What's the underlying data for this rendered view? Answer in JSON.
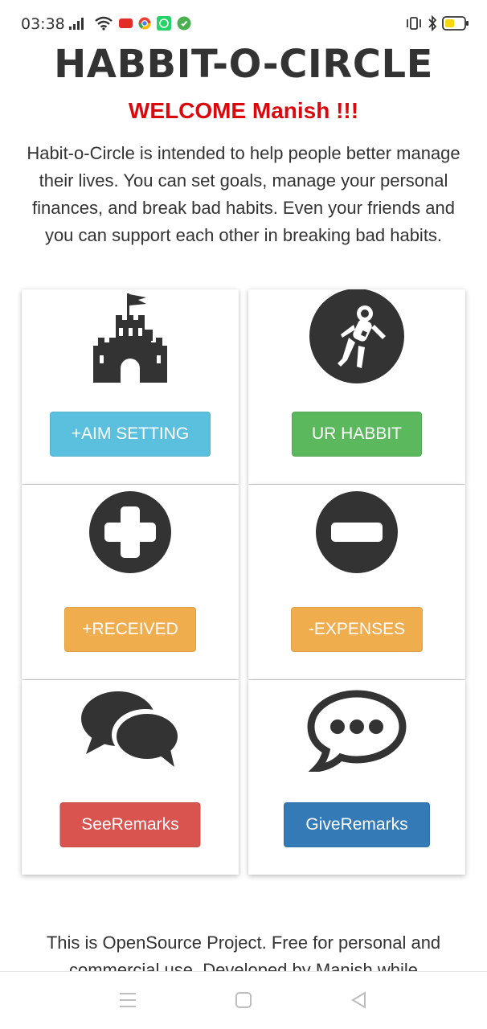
{
  "status": {
    "time": "03:38",
    "colors": {
      "youtube": "#e52d27",
      "chrome": "#4285f4",
      "whatsapp": "#25d366",
      "whatsapp2": "#4caf50",
      "battery": "#f5d90a"
    }
  },
  "header": {
    "title": "HABBIT-O-CIRCLE",
    "welcome": "WELCOME Manish !!!",
    "intro": "Habit-o-Circle is intended to help people better manage their lives. You can set goals, manage your personal finances, and break bad habits. Even your friends and you can support each other in breaking bad habits."
  },
  "cards": [
    {
      "icon": "castle-icon",
      "button": "+AIM SETTING",
      "color": "#5bc0de"
    },
    {
      "icon": "astronaut-icon",
      "button": "UR HABBIT",
      "color": "#5cb85c"
    },
    {
      "icon": "plus-circle-icon",
      "button": "+RECEIVED",
      "color": "#f0ad4e"
    },
    {
      "icon": "minus-circle-icon",
      "button": "-EXPENSES",
      "color": "#f0ad4e"
    },
    {
      "icon": "comments-icon",
      "button": "SeeRemarks",
      "color": "#d9534f"
    },
    {
      "icon": "comment-dots-icon",
      "button": "GiveRemarks",
      "color": "#337ab7"
    }
  ],
  "footer": {
    "text": "This is OpenSource Project. Free for personal and commercial use. Developed by Manish while"
  }
}
